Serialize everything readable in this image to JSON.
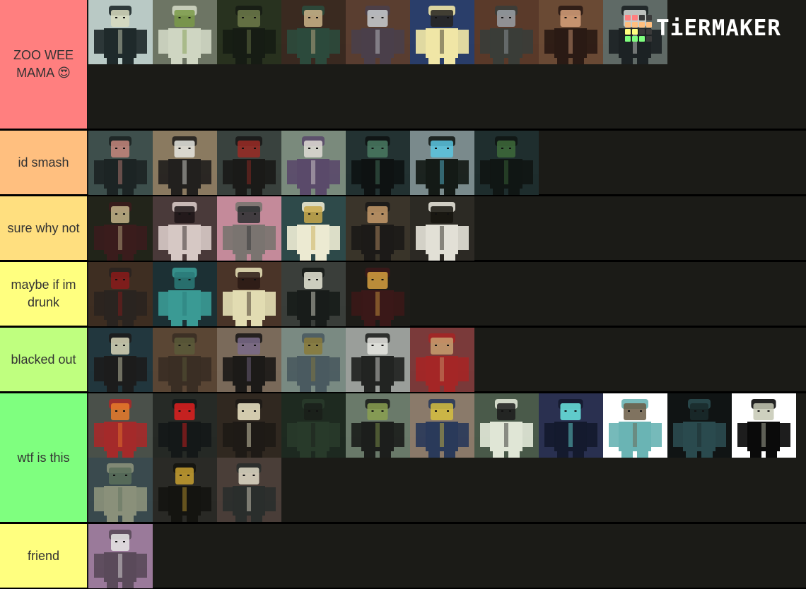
{
  "logo": {
    "text": "TiERMAKER",
    "icon": "tier-grid-icon",
    "grid_colors": [
      "#ff7f7f",
      "#ff7f7f",
      "#3a3a3a",
      "#3a3a3a",
      "#ffbf7f",
      "#ffbf7f",
      "#ffbf7f",
      "#ffbf7f",
      "#ffff7f",
      "#ffff7f",
      "#3a3a3a",
      "#3a3a3a",
      "#7fff7f",
      "#7fff7f",
      "#7fff7f",
      "#3a3a3a"
    ]
  },
  "tiers": [
    {
      "label": "ZOO WEE MAMA 😍",
      "color": "#ff7f7f",
      "items": [
        {
          "name": "black-hooded-cat-ear-character",
          "bg": "#b9c9c5",
          "fg": "#1f2a2b",
          "accent": "#d8dcc0"
        },
        {
          "name": "white-haired-green-outfit-character",
          "bg": "#6d7564",
          "fg": "#cfd6c2",
          "accent": "#7a9a48"
        },
        {
          "name": "dark-green-hooded-character",
          "bg": "#28321f",
          "fg": "#161c14",
          "accent": "#6d7a4a"
        },
        {
          "name": "grey-haired-tan-robe-character",
          "bg": "#3a2a20",
          "fg": "#2c4a3c",
          "accent": "#cdb48a"
        },
        {
          "name": "silver-haired-purple-coat-character",
          "bg": "#5a3e30",
          "fg": "#4a3f4a",
          "accent": "#c8ccd0"
        },
        {
          "name": "blonde-long-haired-character",
          "bg": "#2a3e6a",
          "fg": "#f0e6a6",
          "accent": "#262320"
        },
        {
          "name": "grey-skinned-dark-coat-character",
          "bg": "#5a3a2a",
          "fg": "#3a3d38",
          "accent": "#9aa0a6"
        },
        {
          "name": "flame-pattern-hooded-character",
          "bg": "#6a4a34",
          "fg": "#2a1a14",
          "accent": "#d6a07a"
        },
        {
          "name": "pale-face-black-tears-character",
          "bg": "#5f6a66",
          "fg": "#1c2224",
          "accent": "#d9dcd8"
        }
      ]
    },
    {
      "label": "id smash",
      "color": "#ffbf7f",
      "items": [
        {
          "name": "horned-dark-teal-character",
          "bg": "#3e4f4c",
          "fg": "#1c2424",
          "accent": "#c6867c"
        },
        {
          "name": "striped-sleeves-character",
          "bg": "#8a7a60",
          "fg": "#22201e",
          "accent": "#e6e6e0"
        },
        {
          "name": "red-masked-hat-character",
          "bg": "#39423e",
          "fg": "#1a1a18",
          "accent": "#9a2a24"
        },
        {
          "name": "horned-purple-kimono-character",
          "bg": "#7a8a7c",
          "fg": "#5a4a6a",
          "accent": "#e0dcd6"
        },
        {
          "name": "green-haired-shadow-character",
          "bg": "#233232",
          "fg": "#0e1212",
          "accent": "#4a7a62"
        },
        {
          "name": "blue-haired-horned-character",
          "bg": "#7a8a8c",
          "fg": "#141a16",
          "accent": "#5ac6e0"
        },
        {
          "name": "green-skinned-creature",
          "bg": "#1f2e2e",
          "fg": "#101614",
          "accent": "#3e6a3a"
        }
      ]
    },
    {
      "label": "sure why not",
      "color": "#ffdf7f",
      "items": [
        {
          "name": "blonde-maroon-robe-character",
          "bg": "#22241a",
          "fg": "#3a1c1c",
          "accent": "#c4b48a"
        },
        {
          "name": "black-hair-pale-cloak-character",
          "bg": "#4a3a3a",
          "fg": "#d6c8c4",
          "accent": "#1c1416"
        },
        {
          "name": "masked-teal-eyes-character",
          "bg": "#c48a9a",
          "fg": "#7a7470",
          "accent": "#2a2e30"
        },
        {
          "name": "white-hair-cream-coat-character",
          "bg": "#2e4a4a",
          "fg": "#ecead2",
          "accent": "#c8a84a"
        },
        {
          "name": "curly-hair-black-coat-character",
          "bg": "#3a342a",
          "fg": "#1c1a18",
          "accent": "#c69a6a"
        },
        {
          "name": "white-hooded-robe-character",
          "bg": "#2c2a24",
          "fg": "#e2e0d6",
          "accent": "#16140e"
        }
      ]
    },
    {
      "label": "maybe if im drunk",
      "color": "#ffff7f",
      "items": [
        {
          "name": "black-spiky-hair-red-coat-character",
          "bg": "#3e2e22",
          "fg": "#2a2420",
          "accent": "#8a1a1a"
        },
        {
          "name": "teal-blocky-creature",
          "bg": "#1c3034",
          "fg": "#3a9a94",
          "accent": "#2a7a78"
        },
        {
          "name": "black-cap-sunglasses-character",
          "bg": "#4a3428",
          "fg": "#e2dcb2",
          "accent": "#2a1a14"
        },
        {
          "name": "dark-hooded-glowing-eyes-character",
          "bg": "#3a3e3a",
          "fg": "#181c1a",
          "accent": "#e6e6d6"
        },
        {
          "name": "wide-hat-red-cloak-character",
          "bg": "#1e1c18",
          "fg": "#3a1818",
          "accent": "#d6a040"
        }
      ]
    },
    {
      "label": "blacked out",
      "color": "#bfff7f",
      "items": [
        {
          "name": "spiky-blonde-dark-armor-character",
          "bg": "#22373e",
          "fg": "#1c1c1c",
          "accent": "#d8d6b8"
        },
        {
          "name": "curly-hair-brown-jacket-character",
          "bg": "#5a4634",
          "fg": "#3a2e24",
          "accent": "#5a5a3a"
        },
        {
          "name": "purple-skinned-vest-character",
          "bg": "#7a6a5a",
          "fg": "#1c1a18",
          "accent": "#7a6a8a"
        },
        {
          "name": "armored-knight-character",
          "bg": "#7a8a82",
          "fg": "#4a5a60",
          "accent": "#8a7a3a"
        },
        {
          "name": "tattoo-face-white-coat-character",
          "bg": "#9a9e9a",
          "fg": "#222422",
          "accent": "#e6e6e2"
        },
        {
          "name": "red-tunic-brown-hair-character",
          "bg": "#7a3a3a",
          "fg": "#a42626",
          "accent": "#c8a070"
        }
      ]
    },
    {
      "label": "wtf is this",
      "color": "#7fff7f",
      "items": [
        {
          "name": "orange-spiky-hair-red-tunic-character",
          "bg": "#4a504a",
          "fg": "#a42a2a",
          "accent": "#e87a2a"
        },
        {
          "name": "red-eyed-dark-armor-character",
          "bg": "#262a26",
          "fg": "#141818",
          "accent": "#e02020"
        },
        {
          "name": "bald-dark-coat-lantern-character",
          "bg": "#302820",
          "fg": "#1e1a16",
          "accent": "#f0e8c8"
        },
        {
          "name": "dark-green-plant-creature",
          "bg": "#1e2a20",
          "fg": "#283a2a",
          "accent": "#1a1e1a"
        },
        {
          "name": "bowler-hat-green-vest-character",
          "bg": "#6a7a6a",
          "fg": "#1c1e1c",
          "accent": "#8aa050"
        },
        {
          "name": "black-hair-yellow-streak-character",
          "bg": "#8a7a6a",
          "fg": "#2a3a5a",
          "accent": "#d6c040"
        },
        {
          "name": "white-suit-character",
          "bg": "#4a5a4a",
          "fg": "#e0e6d6",
          "accent": "#1c1c1c"
        },
        {
          "name": "dark-blue-glowing-creature",
          "bg": "#2a3050",
          "fg": "#141a2e",
          "accent": "#6ae6e0"
        },
        {
          "name": "teal-ragged-zombie-character",
          "bg": "#ffffff",
          "fg": "#6ab4b4",
          "accent": "#6a5a44"
        },
        {
          "name": "clustered-teal-heads-creature",
          "bg": "#101414",
          "fg": "#2a4a4e",
          "accent": "#1a2a2c"
        },
        {
          "name": "black-hulking-skull-creature",
          "bg": "#ffffff",
          "fg": "#0a0a0a",
          "accent": "#c6c8b4"
        },
        {
          "name": "pale-spiny-fish-creature",
          "bg": "#3a4a4e",
          "fg": "#8a907a",
          "accent": "#5a6e5a"
        },
        {
          "name": "spiky-black-hair-gold-coat-character",
          "bg": "#2a2a26",
          "fg": "#141410",
          "accent": "#c8a030"
        },
        {
          "name": "bald-dark-armored-character",
          "bg": "#4a3e38",
          "fg": "#2a2e2c",
          "accent": "#e2dcc8"
        }
      ]
    },
    {
      "label": "friend",
      "color": "#ffff7f",
      "items": [
        {
          "name": "purple-golem-holding-mug",
          "bg": "#9a7a9a",
          "fg": "#5a4a5a",
          "accent": "#e8e8e6"
        }
      ]
    }
  ]
}
